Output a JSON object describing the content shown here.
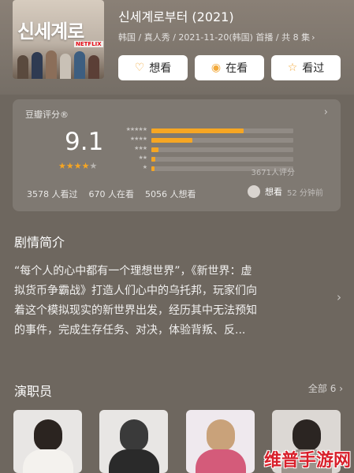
{
  "header": {
    "poster_title": "신세계로",
    "poster_brand": "NETFLIX",
    "title": "신세계로부터 (2021)",
    "meta": "韩国 / 真人秀 / 2021-11-20(韩国) 首播 / 共 8 集",
    "actions": [
      {
        "label": "想看",
        "icon": "heart-icon"
      },
      {
        "label": "在看",
        "icon": "circle-dot-icon"
      },
      {
        "label": "看过",
        "icon": "star-icon"
      }
    ]
  },
  "rating": {
    "label": "豆瓣评分®",
    "score": "9.1",
    "stars": 4.5,
    "distribution": [
      {
        "stars": "★★★★★",
        "percent": 65
      },
      {
        "stars": "★★★★",
        "percent": 29
      },
      {
        "stars": "★★★",
        "percent": 5
      },
      {
        "stars": "★★",
        "percent": 3
      },
      {
        "stars": "★",
        "percent": 2
      }
    ],
    "count_text": "3671人评分",
    "stats": [
      "3578 人看过",
      "670 人在看",
      "5056 人想看"
    ],
    "status_label": "想看",
    "status_time": "52 分钟前"
  },
  "synopsis": {
    "title": "剧情简介",
    "lines": [
      "“每个人的心中都有一个理想世界”，《新世界：虚",
      "拟货币争霸战》打造人们心中的乌托邦，玩家们向",
      "着这个模拟现实的新世界出发，经历其中无法预知",
      "的事件，完成生存任务、对决，体验背叛、反..."
    ]
  },
  "cast": {
    "title": "演职员",
    "all_label": "全部 6",
    "count": 4
  },
  "watermark": "维普手游网",
  "colors": {
    "accent": "#f6a623",
    "background": "#6e675f",
    "watermark": "#d8202b"
  }
}
